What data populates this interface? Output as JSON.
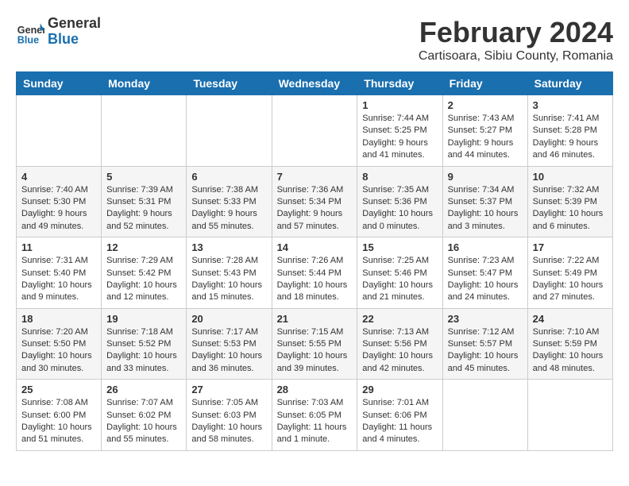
{
  "header": {
    "logo_general": "General",
    "logo_blue": "Blue",
    "month_title": "February 2024",
    "subtitle": "Cartisoara, Sibiu County, Romania"
  },
  "days_of_week": [
    "Sunday",
    "Monday",
    "Tuesday",
    "Wednesday",
    "Thursday",
    "Friday",
    "Saturday"
  ],
  "weeks": [
    [
      {
        "day": "",
        "info": ""
      },
      {
        "day": "",
        "info": ""
      },
      {
        "day": "",
        "info": ""
      },
      {
        "day": "",
        "info": ""
      },
      {
        "day": "1",
        "info": "Sunrise: 7:44 AM\nSunset: 5:25 PM\nDaylight: 9 hours\nand 41 minutes."
      },
      {
        "day": "2",
        "info": "Sunrise: 7:43 AM\nSunset: 5:27 PM\nDaylight: 9 hours\nand 44 minutes."
      },
      {
        "day": "3",
        "info": "Sunrise: 7:41 AM\nSunset: 5:28 PM\nDaylight: 9 hours\nand 46 minutes."
      }
    ],
    [
      {
        "day": "4",
        "info": "Sunrise: 7:40 AM\nSunset: 5:30 PM\nDaylight: 9 hours\nand 49 minutes."
      },
      {
        "day": "5",
        "info": "Sunrise: 7:39 AM\nSunset: 5:31 PM\nDaylight: 9 hours\nand 52 minutes."
      },
      {
        "day": "6",
        "info": "Sunrise: 7:38 AM\nSunset: 5:33 PM\nDaylight: 9 hours\nand 55 minutes."
      },
      {
        "day": "7",
        "info": "Sunrise: 7:36 AM\nSunset: 5:34 PM\nDaylight: 9 hours\nand 57 minutes."
      },
      {
        "day": "8",
        "info": "Sunrise: 7:35 AM\nSunset: 5:36 PM\nDaylight: 10 hours\nand 0 minutes."
      },
      {
        "day": "9",
        "info": "Sunrise: 7:34 AM\nSunset: 5:37 PM\nDaylight: 10 hours\nand 3 minutes."
      },
      {
        "day": "10",
        "info": "Sunrise: 7:32 AM\nSunset: 5:39 PM\nDaylight: 10 hours\nand 6 minutes."
      }
    ],
    [
      {
        "day": "11",
        "info": "Sunrise: 7:31 AM\nSunset: 5:40 PM\nDaylight: 10 hours\nand 9 minutes."
      },
      {
        "day": "12",
        "info": "Sunrise: 7:29 AM\nSunset: 5:42 PM\nDaylight: 10 hours\nand 12 minutes."
      },
      {
        "day": "13",
        "info": "Sunrise: 7:28 AM\nSunset: 5:43 PM\nDaylight: 10 hours\nand 15 minutes."
      },
      {
        "day": "14",
        "info": "Sunrise: 7:26 AM\nSunset: 5:44 PM\nDaylight: 10 hours\nand 18 minutes."
      },
      {
        "day": "15",
        "info": "Sunrise: 7:25 AM\nSunset: 5:46 PM\nDaylight: 10 hours\nand 21 minutes."
      },
      {
        "day": "16",
        "info": "Sunrise: 7:23 AM\nSunset: 5:47 PM\nDaylight: 10 hours\nand 24 minutes."
      },
      {
        "day": "17",
        "info": "Sunrise: 7:22 AM\nSunset: 5:49 PM\nDaylight: 10 hours\nand 27 minutes."
      }
    ],
    [
      {
        "day": "18",
        "info": "Sunrise: 7:20 AM\nSunset: 5:50 PM\nDaylight: 10 hours\nand 30 minutes."
      },
      {
        "day": "19",
        "info": "Sunrise: 7:18 AM\nSunset: 5:52 PM\nDaylight: 10 hours\nand 33 minutes."
      },
      {
        "day": "20",
        "info": "Sunrise: 7:17 AM\nSunset: 5:53 PM\nDaylight: 10 hours\nand 36 minutes."
      },
      {
        "day": "21",
        "info": "Sunrise: 7:15 AM\nSunset: 5:55 PM\nDaylight: 10 hours\nand 39 minutes."
      },
      {
        "day": "22",
        "info": "Sunrise: 7:13 AM\nSunset: 5:56 PM\nDaylight: 10 hours\nand 42 minutes."
      },
      {
        "day": "23",
        "info": "Sunrise: 7:12 AM\nSunset: 5:57 PM\nDaylight: 10 hours\nand 45 minutes."
      },
      {
        "day": "24",
        "info": "Sunrise: 7:10 AM\nSunset: 5:59 PM\nDaylight: 10 hours\nand 48 minutes."
      }
    ],
    [
      {
        "day": "25",
        "info": "Sunrise: 7:08 AM\nSunset: 6:00 PM\nDaylight: 10 hours\nand 51 minutes."
      },
      {
        "day": "26",
        "info": "Sunrise: 7:07 AM\nSunset: 6:02 PM\nDaylight: 10 hours\nand 55 minutes."
      },
      {
        "day": "27",
        "info": "Sunrise: 7:05 AM\nSunset: 6:03 PM\nDaylight: 10 hours\nand 58 minutes."
      },
      {
        "day": "28",
        "info": "Sunrise: 7:03 AM\nSunset: 6:05 PM\nDaylight: 11 hours\nand 1 minute."
      },
      {
        "day": "29",
        "info": "Sunrise: 7:01 AM\nSunset: 6:06 PM\nDaylight: 11 hours\nand 4 minutes."
      },
      {
        "day": "",
        "info": ""
      },
      {
        "day": "",
        "info": ""
      }
    ]
  ]
}
